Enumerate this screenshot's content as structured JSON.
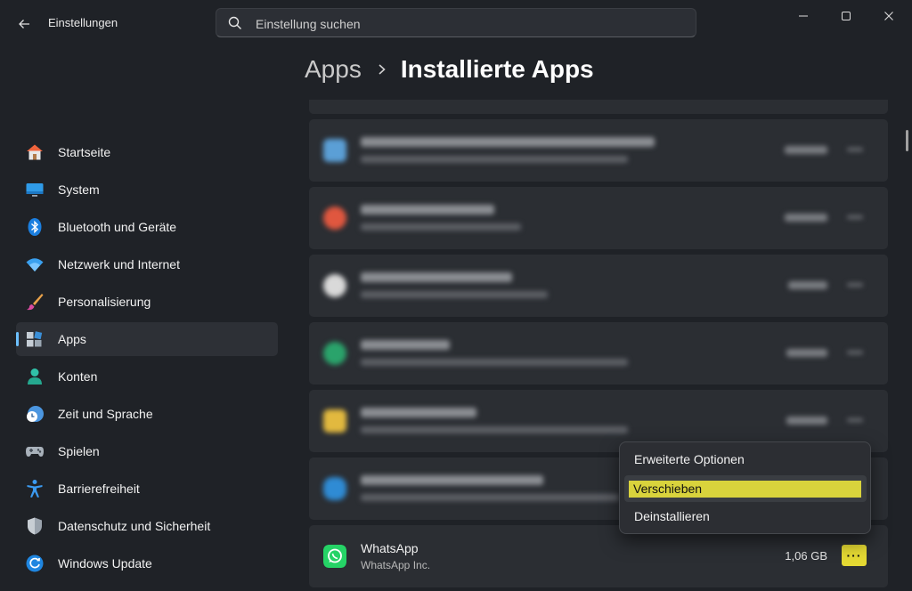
{
  "window": {
    "title": "Einstellungen"
  },
  "search": {
    "placeholder": "Einstellung suchen"
  },
  "breadcrumb": {
    "parent": "Apps",
    "current": "Installierte Apps"
  },
  "sidebar": {
    "items": [
      {
        "label": "Startseite",
        "icon": "home-icon"
      },
      {
        "label": "System",
        "icon": "monitor-icon"
      },
      {
        "label": "Bluetooth und Geräte",
        "icon": "bluetooth-icon"
      },
      {
        "label": "Netzwerk und Internet",
        "icon": "wifi-icon"
      },
      {
        "label": "Personalisierung",
        "icon": "brush-icon"
      },
      {
        "label": "Apps",
        "icon": "apps-icon",
        "selected": true
      },
      {
        "label": "Konten",
        "icon": "person-icon"
      },
      {
        "label": "Zeit und Sprache",
        "icon": "clock-globe-icon"
      },
      {
        "label": "Spielen",
        "icon": "gamepad-icon"
      },
      {
        "label": "Barrierefreiheit",
        "icon": "accessibility-icon"
      },
      {
        "label": "Datenschutz und Sicherheit",
        "icon": "shield-icon"
      },
      {
        "label": "Windows Update",
        "icon": "update-icon"
      }
    ]
  },
  "apps": [
    {
      "name": "WhatsApp",
      "publisher": "WhatsApp Inc.",
      "size": "1,06 GB",
      "more": "···"
    }
  ],
  "context_menu": {
    "items": [
      "Erweiterte Optionen",
      "Verschieben",
      "Deinstallieren"
    ],
    "highlighted": "Verschieben"
  },
  "colors": {
    "accent": "#6cc0ff",
    "highlight": "#e4d933",
    "background": "#1f2227",
    "card": "#2b2e33"
  }
}
